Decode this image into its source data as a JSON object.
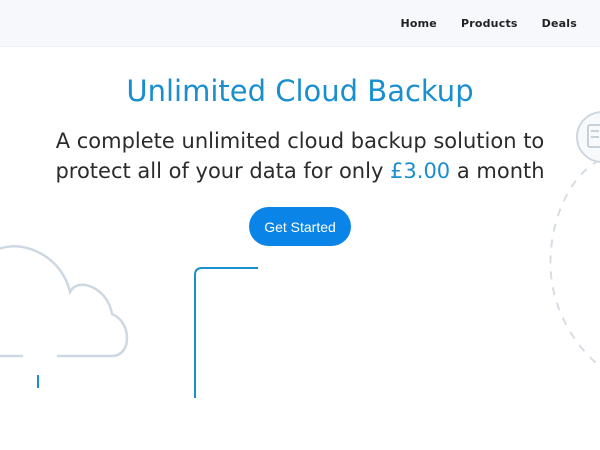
{
  "nav": {
    "items": [
      "Home",
      "Products",
      "Deals"
    ]
  },
  "hero": {
    "title": "Unlimited Cloud Backup",
    "subtitle_prefix": "A complete unlimited cloud backup solution to protect all of your data for only ",
    "price": "£3.00",
    "subtitle_suffix": " a month",
    "cta_label": "Get Started"
  },
  "colors": {
    "accent": "#1a8fd0",
    "button": "#0a84e6",
    "nav_bg": "#f6f8fb",
    "text": "#2b2b2b"
  },
  "icons": [
    "cloud-icon",
    "server-icon"
  ]
}
